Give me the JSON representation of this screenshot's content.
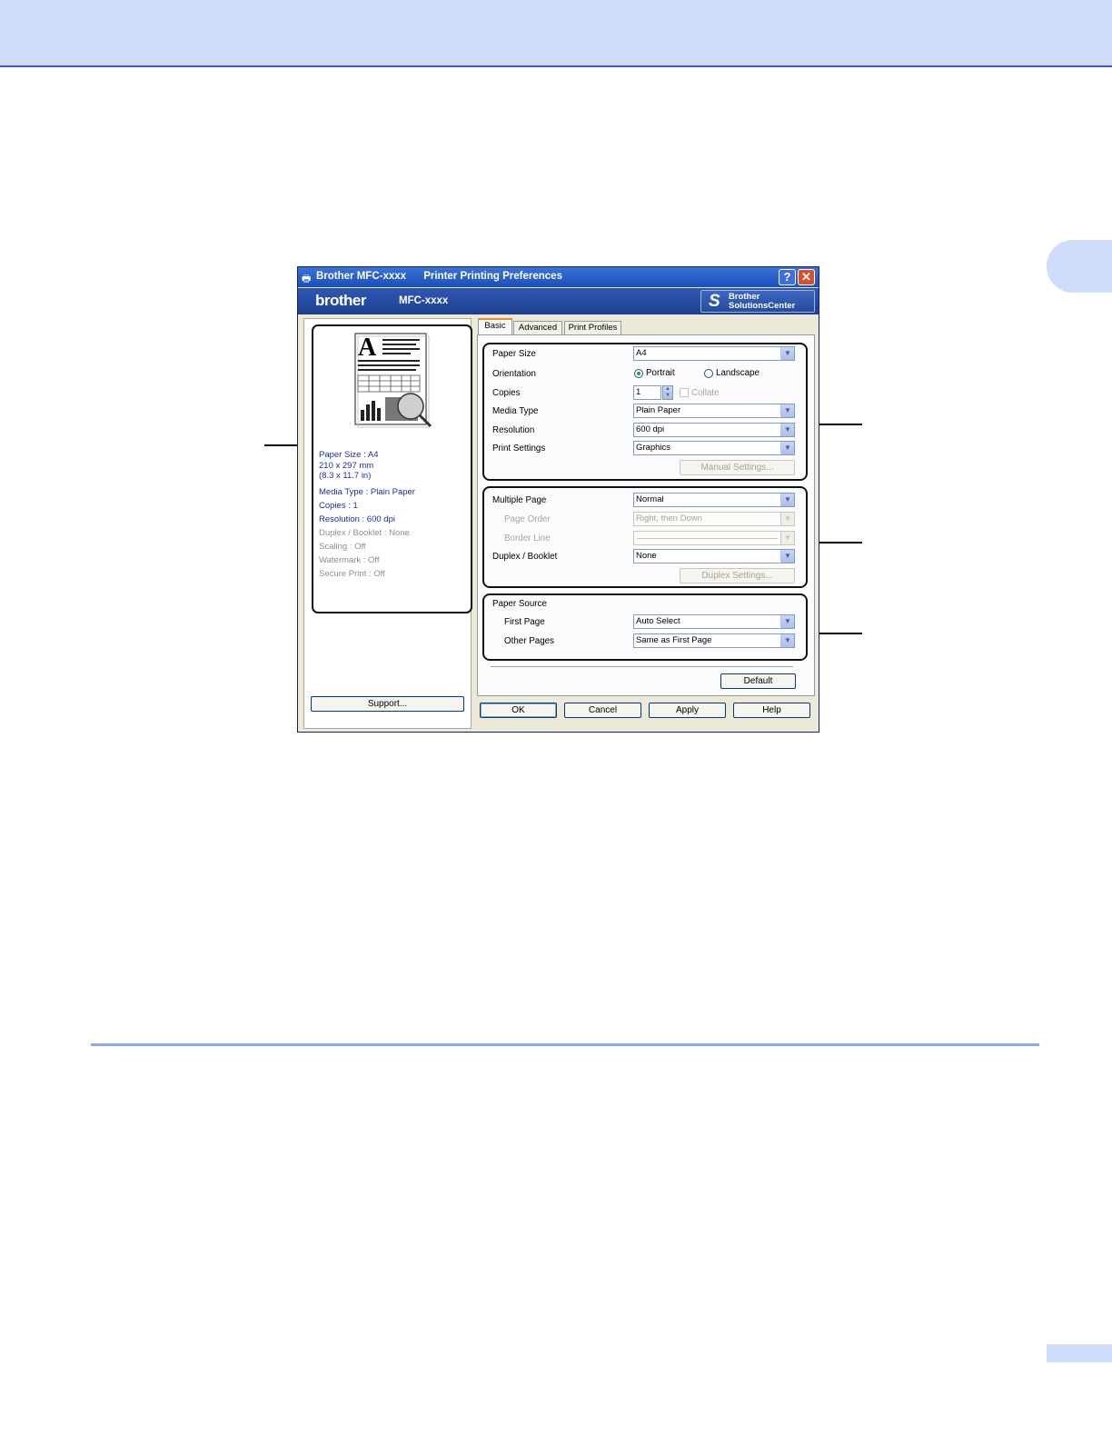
{
  "dialog": {
    "title": "Brother MFC-xxxx      Printer Printing Preferences",
    "brand": "brother",
    "model": "MFC-xxxx",
    "solutions_line1": "Brother",
    "solutions_line2": "SolutionsCenter",
    "help_glyph": "?",
    "close_glyph": "✕"
  },
  "tabs": [
    {
      "label": "Basic",
      "active": true
    },
    {
      "label": "Advanced",
      "active": false
    },
    {
      "label": "Print Profiles",
      "active": false
    }
  ],
  "summary": {
    "paper_size": "Paper Size : A4",
    "dimensions_mm": "210 x 297 mm",
    "dimensions_in": "(8.3 x 11.7 in)",
    "media_type": "Media Type : Plain Paper",
    "copies": "Copies : 1",
    "resolution": "Resolution : 600 dpi",
    "duplex": "Duplex / Booklet : None",
    "scaling": "Scaling : Off",
    "watermark": "Watermark : Off",
    "secure_print": "Secure Print : Off"
  },
  "preview_letter": "A",
  "settings": {
    "paper_size": {
      "label": "Paper Size",
      "value": "A4"
    },
    "orientation": {
      "label": "Orientation",
      "portrait": "Portrait",
      "landscape": "Landscape",
      "selected": "Portrait"
    },
    "copies": {
      "label": "Copies",
      "value": "1",
      "collate": "Collate"
    },
    "media_type": {
      "label": "Media Type",
      "value": "Plain Paper"
    },
    "resolution": {
      "label": "Resolution",
      "value": "600 dpi"
    },
    "print_settings": {
      "label": "Print Settings",
      "value": "Graphics"
    },
    "manual_settings_btn": "Manual Settings...",
    "multiple_page": {
      "label": "Multiple Page",
      "value": "Normal"
    },
    "page_order": {
      "label": "Page Order",
      "value": "Right, then Down"
    },
    "border_line": {
      "label": "Border Line",
      "value": ""
    },
    "duplex": {
      "label": "Duplex / Booklet",
      "value": "None"
    },
    "duplex_settings_btn": "Duplex Settings...",
    "paper_source": {
      "label": "Paper Source"
    },
    "first_page": {
      "label": "First Page",
      "value": "Auto Select"
    },
    "other_pages": {
      "label": "Other Pages",
      "value": "Same as First Page"
    }
  },
  "buttons": {
    "default": "Default",
    "support": "Support...",
    "ok": "OK",
    "cancel": "Cancel",
    "apply": "Apply",
    "help": "Help"
  },
  "icons": {
    "title_app": "printer-icon",
    "combo_arrow": "▼",
    "spin_up": "▲",
    "spin_down": "▼"
  }
}
